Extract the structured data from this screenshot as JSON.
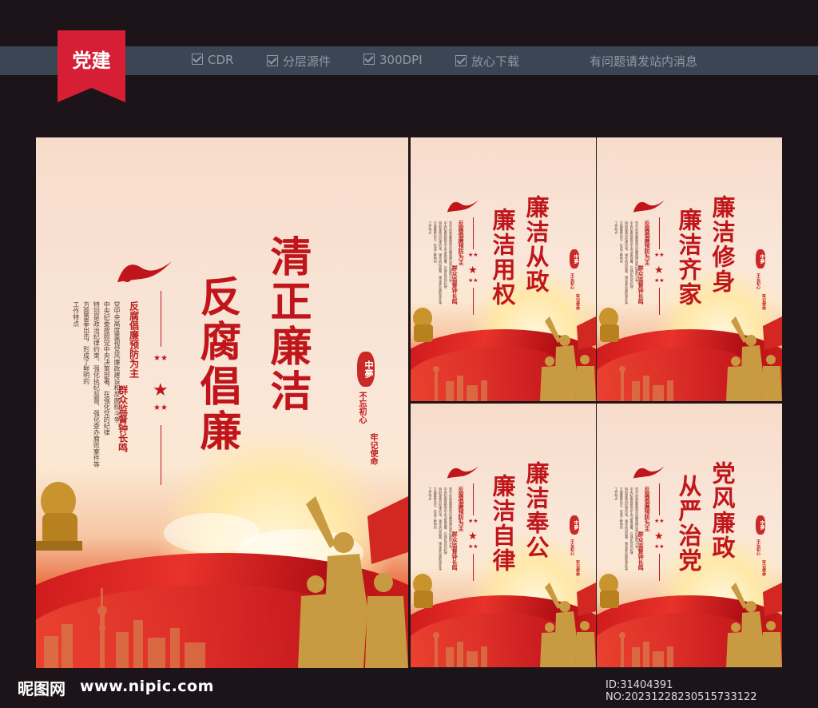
{
  "header": {
    "ribbon_label": "党建",
    "features": [
      "CDR",
      "分层源件",
      "300DPI",
      "放心下载"
    ],
    "help": "有问题请发站内消息"
  },
  "main_poster": {
    "title_right": "清正廉洁",
    "title_left": "反腐倡廉",
    "slogan_1": "反腐倡廉预防为主",
    "slogan_2": "群众监督钟长鸣",
    "body_lines": [
      "党中央高度重视党风廉政建设和反腐败斗争。",
      "中央纪委按照党中央决策部署，在强化党的纪律",
      "特别是政治纪律约束、强化执纪监督、强化查办腐败案件等",
      "方面重拳出击，形成了鲜明的",
      "工作特点"
    ],
    "seal": "中夢",
    "motto_1": "不忘初心",
    "motto_2": "牢记使命"
  },
  "small_posters": [
    {
      "col1": "廉洁从政",
      "col2": "廉洁用权"
    },
    {
      "col1": "廉洁修身",
      "col2": "廉洁齐家"
    },
    {
      "col1": "廉洁奉公",
      "col2": "廉洁自律"
    },
    {
      "col1": "党风廉政",
      "col2": "从严治党"
    }
  ],
  "small_common": {
    "slogan_1": "反腐倡廉预防为主",
    "slogan_2": "群众监督钟长鸣"
  },
  "footer": {
    "brand": "昵图网",
    "url": "www.nipic.com",
    "id_text": "ID:31404391 NO:20231228230515733122"
  },
  "colors": {
    "accent": "#c0161b",
    "ribbon": "#d61e34",
    "bar": "#3a4654"
  }
}
